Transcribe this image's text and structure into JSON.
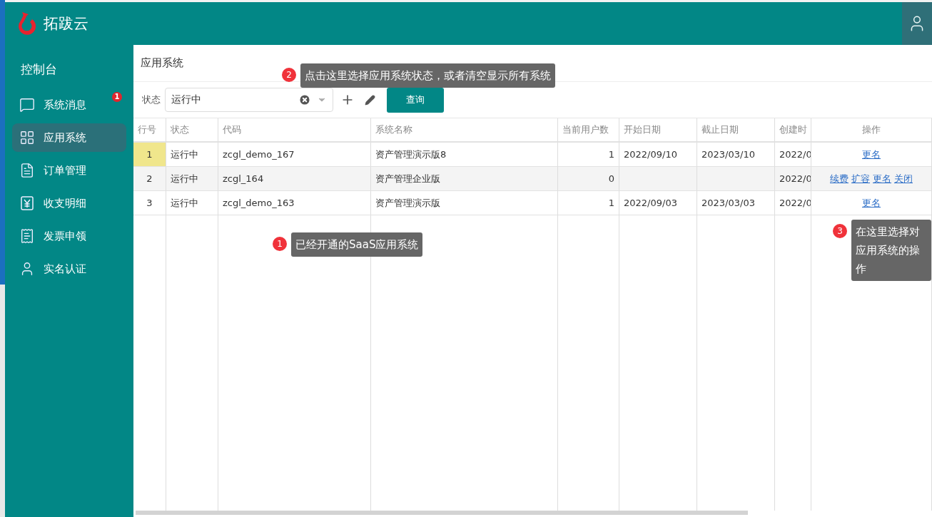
{
  "header": {
    "brand": "拓跋云"
  },
  "sidebar": {
    "title": "控制台",
    "items": [
      {
        "label": "系统消息",
        "kind": "message",
        "badge": "1",
        "selected": false
      },
      {
        "label": "应用系统",
        "kind": "grid",
        "selected": true
      },
      {
        "label": "订单管理",
        "kind": "document",
        "selected": false
      },
      {
        "label": "收支明细",
        "kind": "yen",
        "selected": false
      },
      {
        "label": "发票申领",
        "kind": "ticket",
        "selected": false
      },
      {
        "label": "实名认证",
        "kind": "user",
        "selected": false
      }
    ]
  },
  "page": {
    "title": "应用系统"
  },
  "filter": {
    "label": "状态",
    "value": "运行中",
    "query_button": "查询"
  },
  "table": {
    "columns": [
      "行号",
      "状态",
      "代码",
      "系统名称",
      "当前用户数",
      "开始日期",
      "截止日期",
      "创建时",
      "操作"
    ],
    "rows": [
      {
        "selected": true,
        "cells": [
          "1",
          "运行中",
          "zcgl_demo_167",
          "资产管理演示版8",
          "1",
          "2022/09/10",
          "2023/03/10",
          "2022/0"
        ],
        "actions": [
          "更名"
        ]
      },
      {
        "selected": false,
        "cells": [
          "2",
          "运行中",
          "zcgl_164",
          "资产管理企业版",
          "0",
          "",
          "",
          "2022/0"
        ],
        "actions": [
          "续费",
          "扩容",
          "更名",
          "关闭"
        ]
      },
      {
        "selected": false,
        "cells": [
          "3",
          "运行中",
          "zcgl_demo_163",
          "资产管理演示版",
          "1",
          "2022/09/03",
          "2023/03/03",
          "2022/0"
        ],
        "actions": [
          "更名"
        ]
      }
    ]
  },
  "callouts": [
    {
      "number": "2",
      "text": "点击这里选择应用系统状态，或者清空显示所有系统"
    },
    {
      "number": "1",
      "text": "已经开通的SaaS应用系统"
    },
    {
      "number": "3",
      "text": "在这里选择对应用系统的操作"
    }
  ]
}
